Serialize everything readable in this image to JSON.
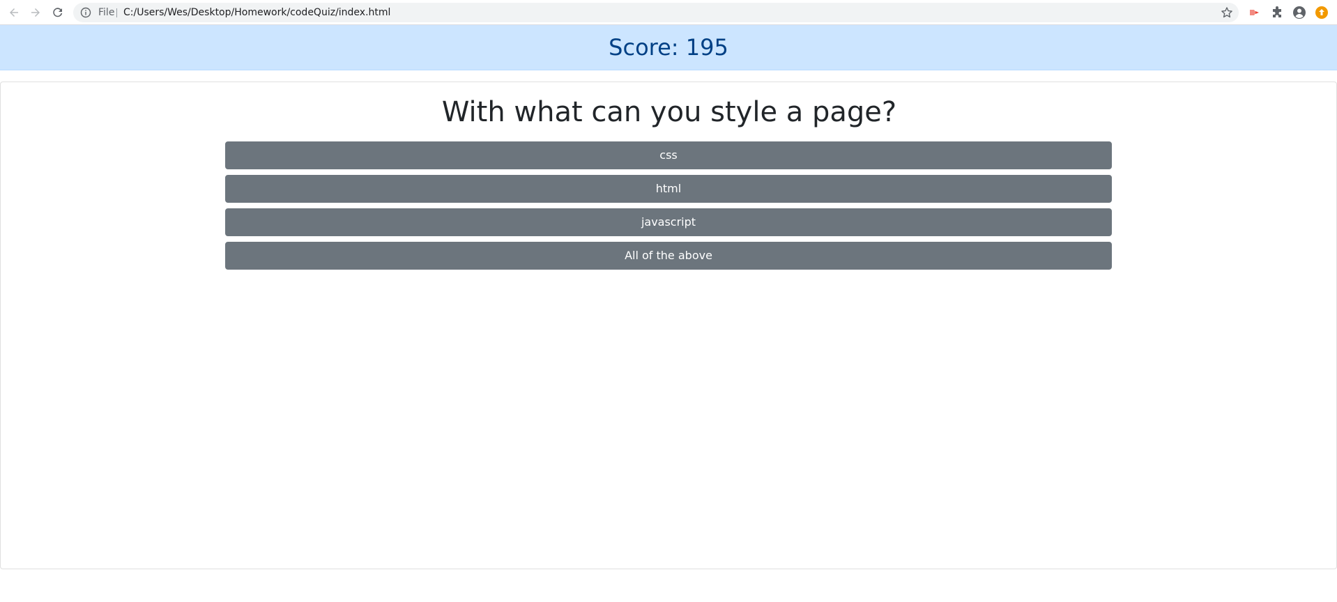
{
  "browser": {
    "scheme_label": "File",
    "url": "C:/Users/Wes/Desktop/Homework/codeQuiz/index.html",
    "icons": [
      "back-arrow-icon",
      "forward-arrow-icon",
      "reload-icon",
      "info-icon",
      "star-icon",
      "extension-red-icon",
      "puzzle-icon",
      "profile-icon",
      "update-icon"
    ]
  },
  "score": {
    "text": "Score: 195"
  },
  "quiz": {
    "question": "With what can you style a page?",
    "answers": [
      "css",
      "html",
      "javascript",
      "All of the above"
    ]
  },
  "colors": {
    "banner_bg": "#cce5ff",
    "banner_text": "#004085",
    "button_bg": "#6c757d",
    "button_text": "#ffffff",
    "question_text": "#212529"
  }
}
